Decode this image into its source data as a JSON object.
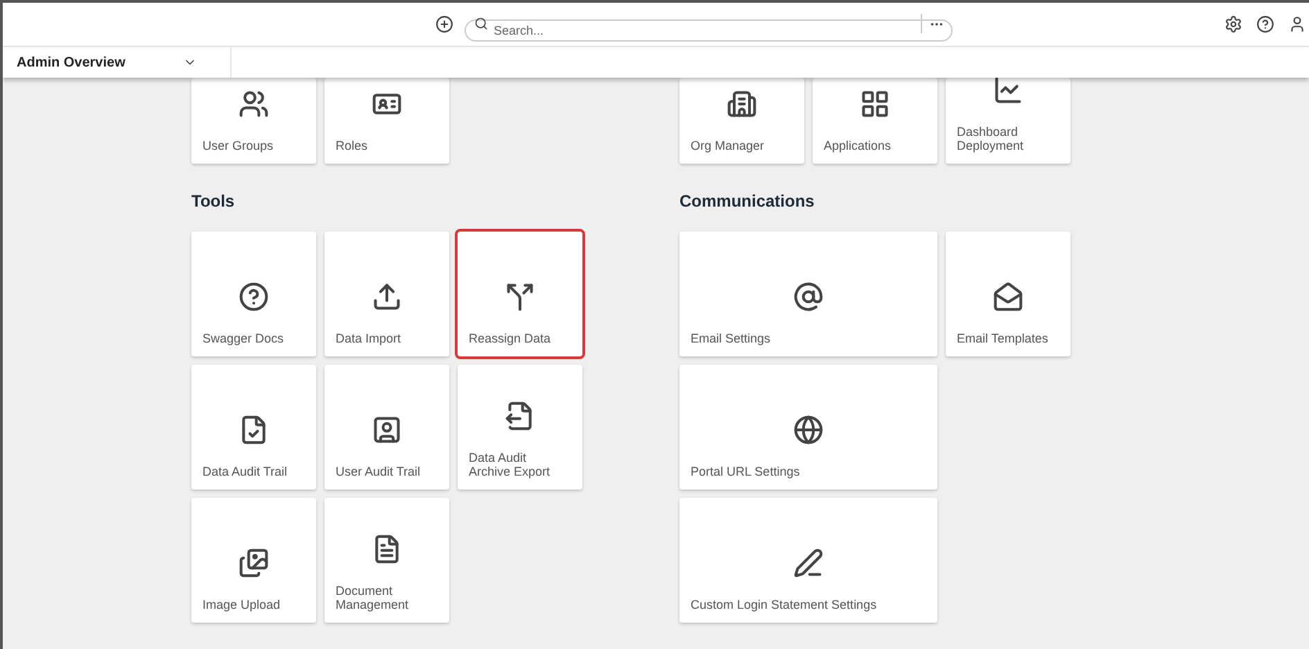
{
  "top_bar": {
    "search": {
      "placeholder": "Search..."
    }
  },
  "nav": {
    "title": "Admin Overview"
  },
  "top_left_tiles": [
    {
      "label": "User Groups"
    },
    {
      "label": "Roles"
    }
  ],
  "top_right_tiles": [
    {
      "label": "Org Manager"
    },
    {
      "label": "Applications"
    },
    {
      "label": "Dashboard Deployment"
    }
  ],
  "tools": {
    "title": "Tools",
    "tiles": [
      {
        "label": "Swagger Docs",
        "highlighted": false
      },
      {
        "label": "Data Import",
        "highlighted": false
      },
      {
        "label": "Reassign Data",
        "highlighted": true
      },
      {
        "label": "Data Audit Trail",
        "highlighted": false
      },
      {
        "label": "User Audit Trail",
        "highlighted": false
      },
      {
        "label": "Data Audit Archive Export",
        "highlighted": false
      },
      {
        "label": "Image Upload",
        "highlighted": false
      },
      {
        "label": "Document Management",
        "highlighted": false
      }
    ]
  },
  "communications": {
    "title": "Communications",
    "tiles": [
      {
        "label": "Email Settings",
        "highlighted": false
      },
      {
        "label": "Email Templates",
        "highlighted": false
      },
      {
        "label": "Portal URL Settings",
        "highlighted": false
      },
      {
        "label": "Custom Login Statement Settings",
        "highlighted": false
      }
    ]
  }
}
